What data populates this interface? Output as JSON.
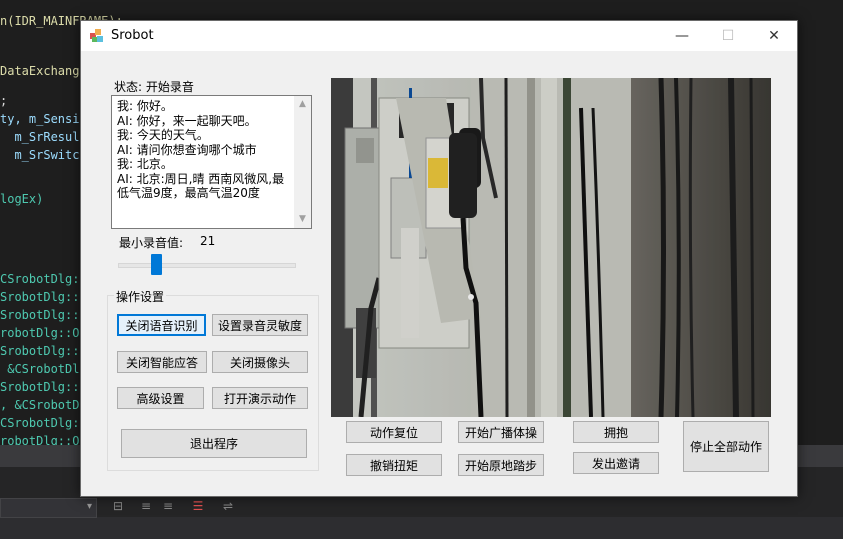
{
  "ide": {
    "code_lines": [
      {
        "text": "n(IDR_MAINFRAME);",
        "cls": "c-yellow"
      },
      {
        "text": "DataExchange(",
        "cls": "c-yellow"
      },
      {
        "text": ";",
        "cls": ""
      },
      {
        "text": "ty, m_Sensit",
        "cls": "c-blue"
      },
      {
        "text": "  m_SrResult",
        "cls": "c-blue"
      },
      {
        "text": "  m_SrSwitch",
        "cls": "c-blue"
      },
      {
        "text": "logEx)",
        "cls": "c-teal"
      },
      {
        "text": "CSrobotDlg:",
        "cls": "c-teal"
      },
      {
        "text": "SrobotDlg::",
        "cls": "c-teal"
      },
      {
        "text": "SrobotDlg::",
        "cls": "c-teal"
      },
      {
        "text": "robotDlg::On",
        "cls": "c-teal"
      },
      {
        "text": "SrobotDlg::C",
        "cls": "c-teal"
      },
      {
        "text": " &CSrobotDlg",
        "cls": "c-teal"
      },
      {
        "text": "SrobotDlg::",
        "cls": "c-teal"
      },
      {
        "text": ", &CSrobotDl",
        "cls": "c-teal"
      },
      {
        "text": "CSrobotDlg::",
        "cls": "c-teal"
      },
      {
        "text": "robotDlg::OnB",
        "cls": "c-teal"
      },
      {
        "text": "SrobotDlg::O",
        "cls": "c-teal"
      }
    ]
  },
  "window": {
    "title": "Srobot",
    "min_glyph": "—",
    "max_glyph": "☐",
    "close_glyph": "✕"
  },
  "status": {
    "label": "状态: 开始录音"
  },
  "chat": {
    "lines": [
      "我: 你好。",
      "AI: 你好，来一起聊天吧。",
      "我: 今天的天气。",
      "AI: 请问你想查询哪个城市",
      "我: 北京。",
      "AI: 北京:周日,晴 西南风微风,最低气温9度，最高气温20度"
    ]
  },
  "min_volume": {
    "label": "最小录音值:",
    "value": "21",
    "slider_fraction": 0.2
  },
  "ops": {
    "legend": "操作设置",
    "close_speech": "关闭语音识别",
    "set_sensitivity": "设置录音灵敏度",
    "close_smart_reply": "关闭智能应答",
    "close_camera": "关闭摄像头",
    "advanced": "高级设置",
    "open_demo": "打开演示动作",
    "exit": "退出程序"
  },
  "actions": {
    "reset": "动作复位",
    "start_broadcast": "开始广播体操",
    "hug": "拥抱",
    "stop_all": "停止全部动作",
    "undo_torque": "撤销扭矩",
    "start_stepping": "开始原地踏步",
    "invite": "发出邀请"
  },
  "icons": {
    "app": "robot-app-icon",
    "scroll_up": "chevron-up-icon",
    "scroll_down": "chevron-down-icon"
  }
}
